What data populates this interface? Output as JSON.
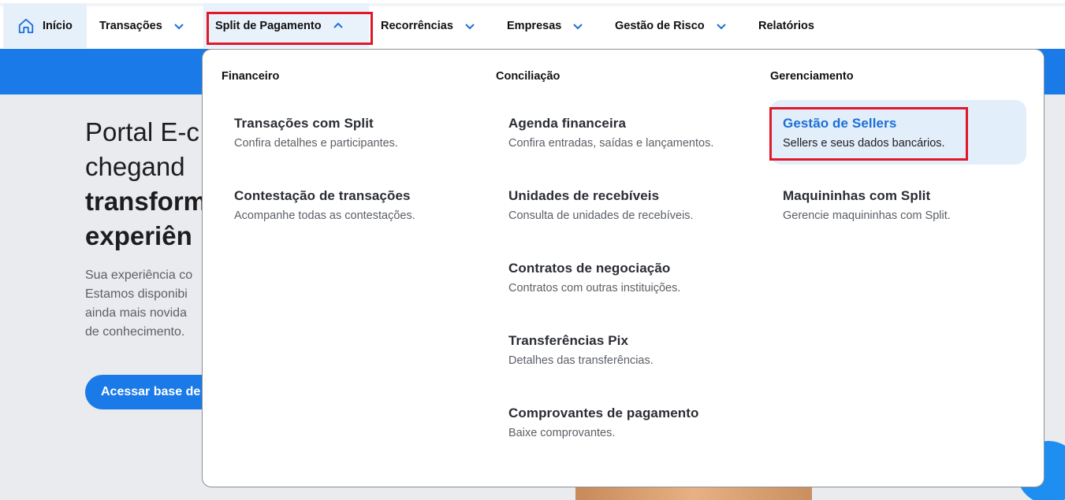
{
  "nav": {
    "home": "Início",
    "items": [
      "Transações",
      "Split de Pagamento",
      "Recorrências",
      "Empresas",
      "Gestão de Risco",
      "Relatórios"
    ]
  },
  "hero": {
    "line1": "Portal E-c",
    "line2": "chegand",
    "line3": "transform",
    "line4": "experiên",
    "text1": "Sua experiência co",
    "text2": "Estamos disponibi",
    "text3": "ainda mais novida",
    "text4": "de conhecimento.",
    "button": "Acessar base de"
  },
  "menu": {
    "columns": [
      {
        "title": "Financeiro",
        "links": [
          {
            "title": "Transações com Split",
            "desc": "Confira detalhes e participantes."
          },
          {
            "title": "Contestação de transações",
            "desc": "Acompanhe todas as contestações."
          }
        ]
      },
      {
        "title": "Conciliação",
        "links": [
          {
            "title": "Agenda financeira",
            "desc": "Confira entradas, saídas e lançamentos."
          },
          {
            "title": "Unidades de recebíveis",
            "desc": "Consulta de unidades de recebíveis."
          },
          {
            "title": "Contratos de negociação",
            "desc": "Contratos com outras instituições."
          },
          {
            "title": "Transferências Pix",
            "desc": "Detalhes das transferências."
          },
          {
            "title": "Comprovantes de pagamento",
            "desc": "Baixe comprovantes."
          }
        ]
      },
      {
        "title": "Gerenciamento",
        "links": [
          {
            "title": "Gestão de Sellers",
            "desc": "Sellers e seus dados bancários."
          },
          {
            "title": "Maquininhas com Split",
            "desc": "Gerencie maquininhas com Split."
          }
        ]
      }
    ]
  },
  "colors": {
    "brand": "#1a7ae8",
    "highlight": "#e0192a"
  }
}
